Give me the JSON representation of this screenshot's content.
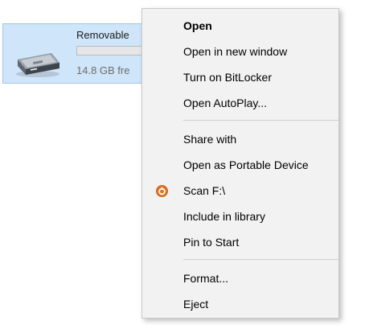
{
  "drive": {
    "name": "Removable",
    "free_text": "14.8 GB fre"
  },
  "context_menu": {
    "items": [
      {
        "label": "Open",
        "bold": true
      },
      {
        "label": "Open in new window"
      },
      {
        "label": "Turn on BitLocker"
      },
      {
        "label": "Open AutoPlay..."
      },
      {
        "label": "Share with"
      },
      {
        "label": "Open as Portable Device"
      },
      {
        "label": "Scan F:\\",
        "icon": "antivirus-scan-icon"
      },
      {
        "label": "Include in library"
      },
      {
        "label": "Pin to Start"
      },
      {
        "label": "Format..."
      },
      {
        "label": "Eject"
      }
    ]
  },
  "colors": {
    "selection_bg": "#cfe5f9",
    "menu_bg": "#f2f2f2",
    "scan_icon": "#e5731d"
  }
}
